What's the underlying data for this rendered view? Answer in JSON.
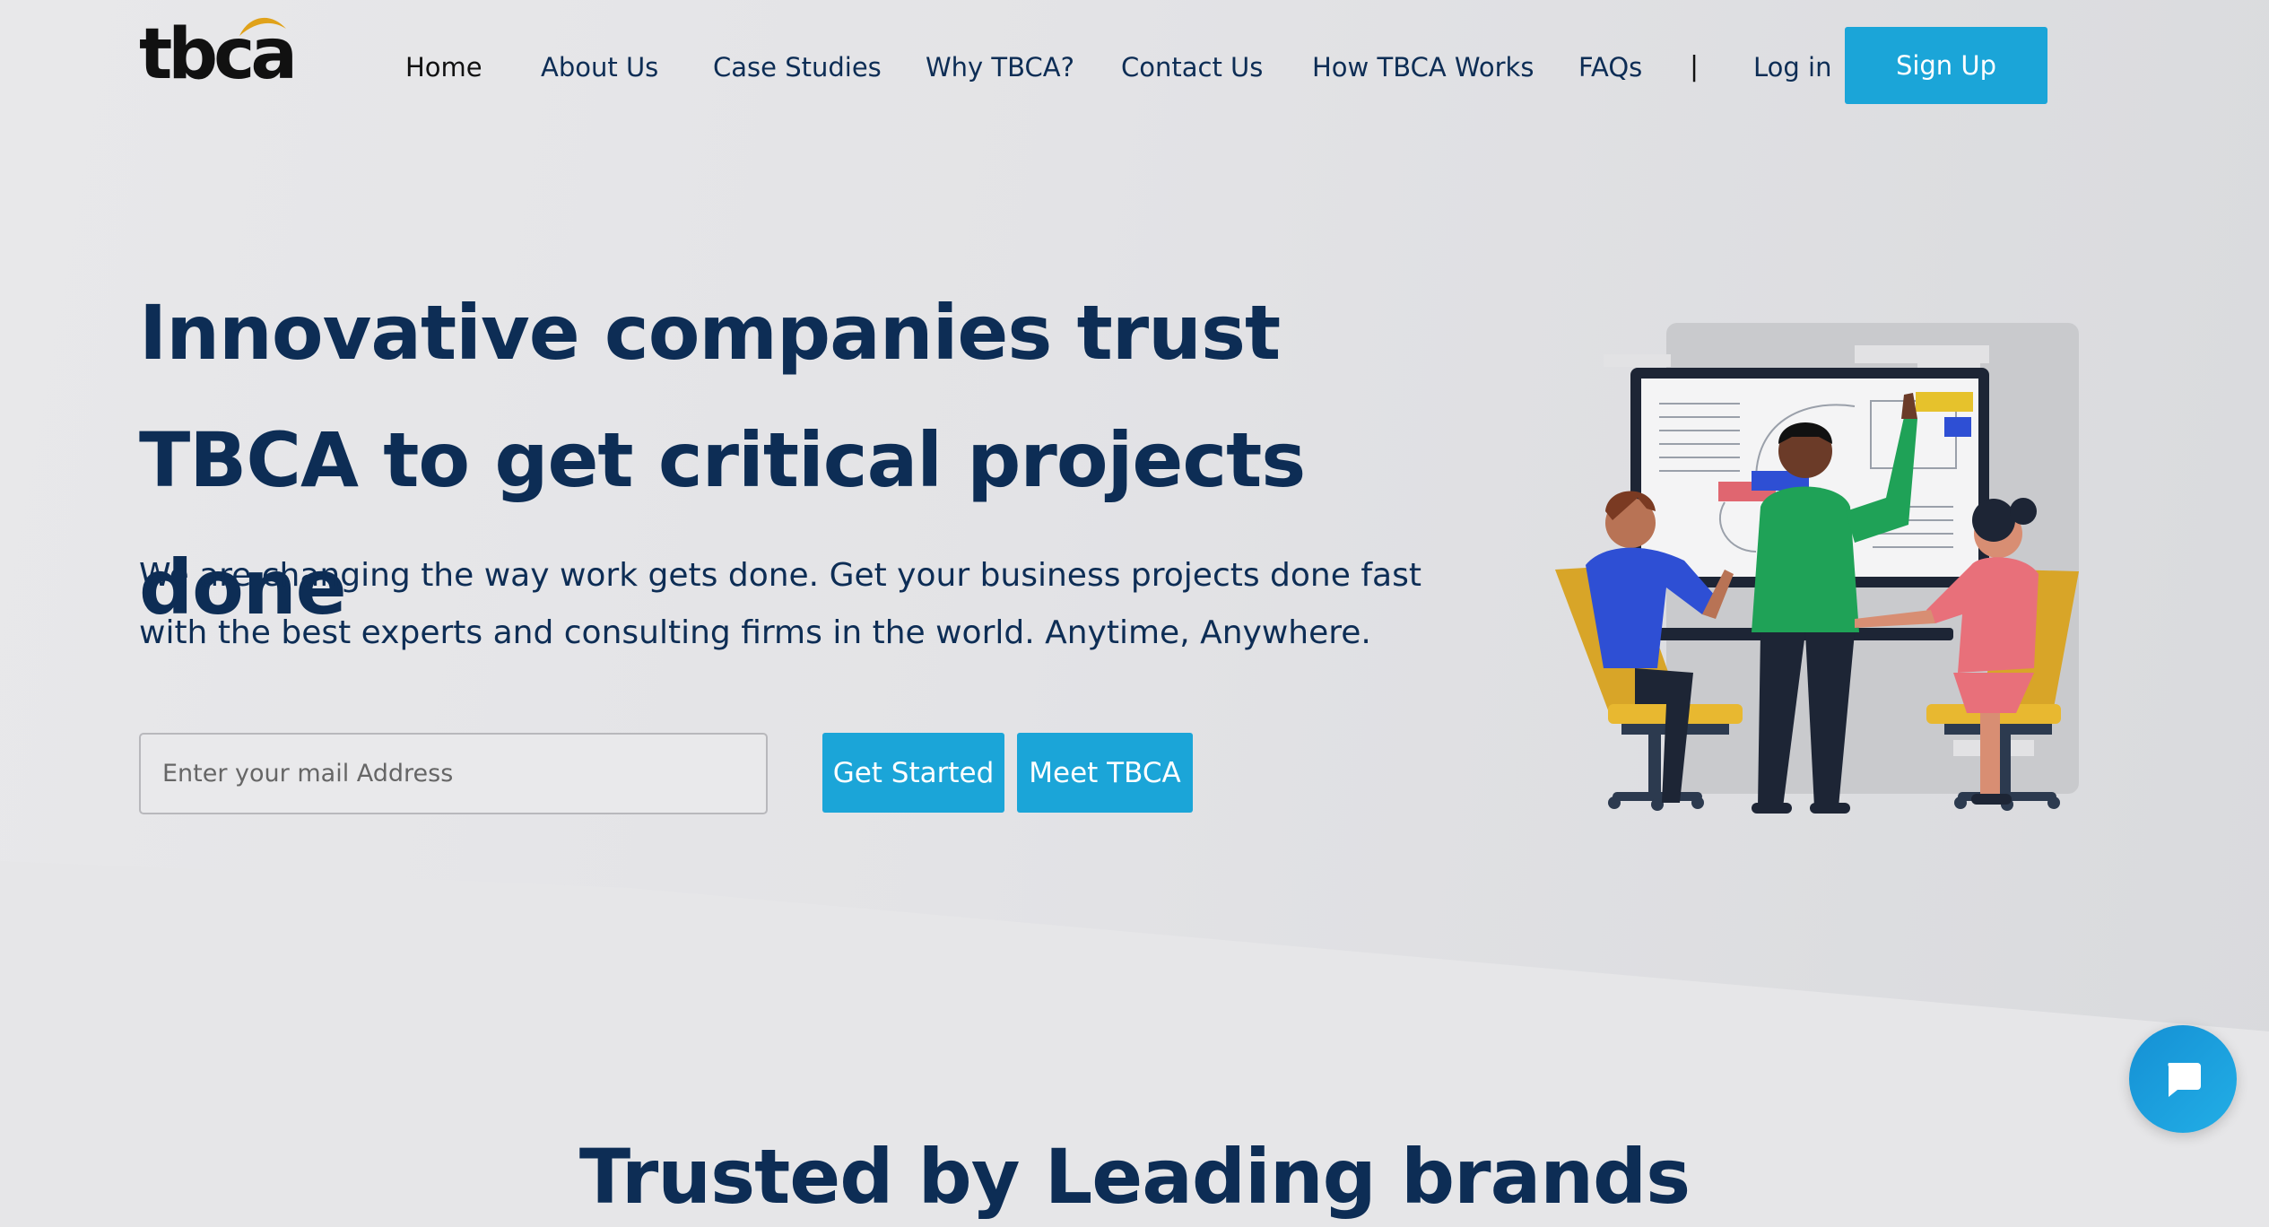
{
  "brand": {
    "logo_text": "tbca",
    "accent": "#1ba5d8",
    "text_color": "#0d2d55",
    "logo_gold": "#e0a21a"
  },
  "nav": {
    "items": [
      {
        "label": "Home"
      },
      {
        "label": "About Us"
      },
      {
        "label": "Case Studies"
      },
      {
        "label": "Why TBCA?"
      },
      {
        "label": "Contact Us"
      },
      {
        "label": "How TBCA Works"
      },
      {
        "label": "FAQs"
      }
    ],
    "separator": "|",
    "login": "Log in",
    "signup": "Sign Up"
  },
  "hero": {
    "title": "Innovative companies trust TBCA to get critical projects done",
    "subtitle": "We are changing the way work gets done. Get your business projects done fast with the best experts and consulting firms in the world. Anytime, Anywhere.",
    "email_placeholder": "Enter your mail Address",
    "cta_primary": "Get Started",
    "cta_secondary": "Meet TBCA"
  },
  "trusted": {
    "title": "Trusted by Leading brands"
  },
  "chat": {
    "icon": "chat-bubble-icon"
  }
}
